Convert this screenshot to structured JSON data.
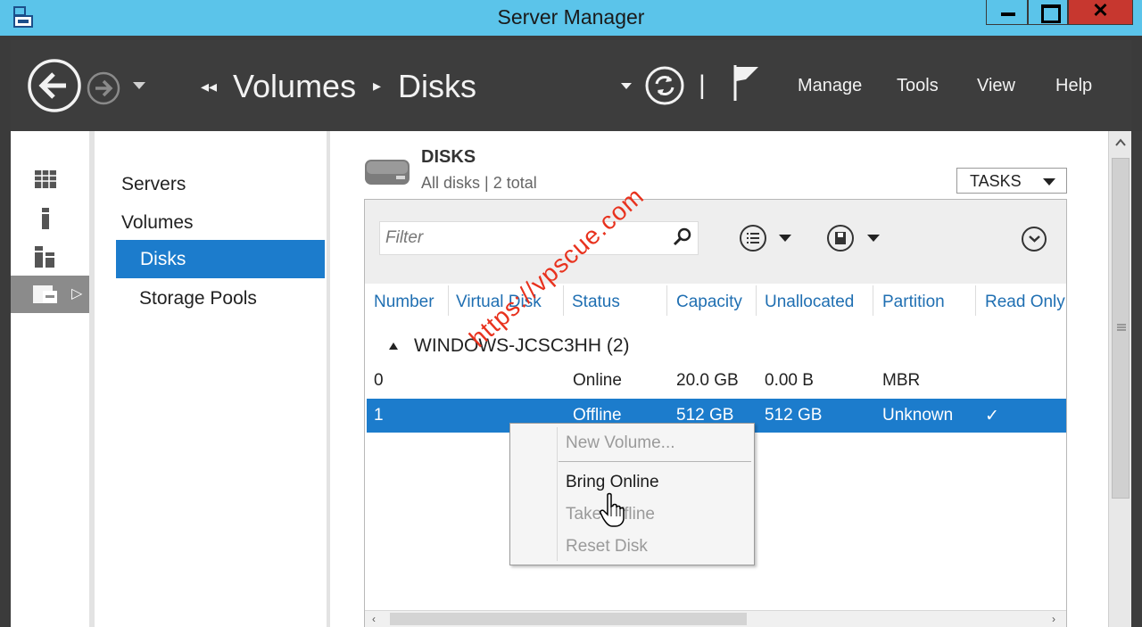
{
  "window": {
    "title": "Server Manager",
    "close_glyph": "✕",
    "app_icon": "server-manager-icon"
  },
  "toolbar": {
    "breadcrumb": [
      "Volumes",
      "Disks"
    ],
    "breadcrumb_prefix": "◂◂",
    "breadcrumb_sep": "▸",
    "menu": [
      "Manage",
      "Tools",
      "View",
      "Help"
    ],
    "divider": "|"
  },
  "left_strip": {
    "icons": [
      "dashboard-icon",
      "local-server-icon",
      "all-servers-icon",
      "file-storage-icon"
    ],
    "expand_glyph": "▷"
  },
  "nav": {
    "items": [
      "Servers",
      "Volumes",
      "Disks",
      "Storage Pools"
    ],
    "selected": "Disks"
  },
  "section": {
    "title": "DISKS",
    "subtitle": "All disks | 2 total",
    "tasks_label": "TASKS"
  },
  "filter": {
    "placeholder": "Filter"
  },
  "table": {
    "columns": [
      "Number",
      "Virtual Disk",
      "Status",
      "Capacity",
      "Unallocated",
      "Partition",
      "Read Only"
    ],
    "group": "WINDOWS-JCSC3HH (2)",
    "rows": [
      {
        "number": "0",
        "virtual_disk": "",
        "status": "Online",
        "capacity": "20.0 GB",
        "unallocated": "0.00 B",
        "partition": "MBR",
        "read_only": ""
      },
      {
        "number": "1",
        "virtual_disk": "",
        "status": "Offline",
        "capacity": "512 GB",
        "unallocated": "512 GB",
        "partition": "Unknown",
        "read_only": "✓"
      }
    ],
    "selected_row": 1
  },
  "context_menu": {
    "items": [
      {
        "label": "New Volume...",
        "enabled": false
      },
      {
        "label": "Bring Online",
        "enabled": true
      },
      {
        "label": "Take Offline",
        "enabled": false
      },
      {
        "label": "Reset Disk",
        "enabled": false
      }
    ]
  },
  "watermark": "https://vpscue.com",
  "colors": {
    "title_bar": "#5bc4ea",
    "toolbar": "#3d3d3d",
    "selection": "#1c7ccc",
    "close": "#c7372f",
    "header_text": "#1f6fb2",
    "watermark": "#e8321e"
  }
}
